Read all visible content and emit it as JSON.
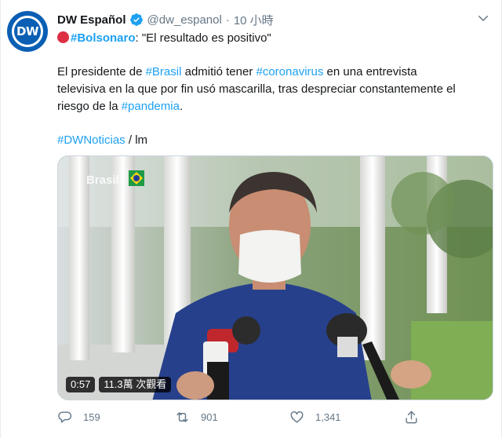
{
  "account": {
    "avatar_text": "DW",
    "display_name": "DW Español",
    "handle": "@dw_espanol",
    "separator": "·",
    "time": "10 小時"
  },
  "tweet": {
    "headline_hashtag": "#Bolsonaro",
    "headline_rest": ": \"El resultado es positivo\"",
    "line1_pre": "El presidente de ",
    "line1_hashtag1": "#Brasil",
    "line1_mid": " admitió tener ",
    "line1_hashtag2": "#coronavirus",
    "line1_post": " en una entrevista",
    "line2": "televisiva en la que por fin usó mascarilla, tras despreciar constantemente el",
    "line3_pre": "riesgo de la ",
    "line3_hashtag": "#pandemia",
    "line3_post": ".",
    "footer_hashtag": "#DWNoticias",
    "footer_rest": " / lm"
  },
  "video": {
    "watermark": "Brasil",
    "duration": "0:57",
    "views": "11.3萬 次觀看"
  },
  "actions": {
    "reply_count": "159",
    "retweet_count": "901",
    "like_count": "1,341"
  },
  "colors": {
    "link": "#1da1f2",
    "secondary": "#657786",
    "brand": "#0a5fb4"
  },
  "icons": [
    "verified-icon",
    "more-caret-icon",
    "red-circle-icon",
    "reply-icon",
    "retweet-icon",
    "like-icon",
    "share-icon"
  ]
}
